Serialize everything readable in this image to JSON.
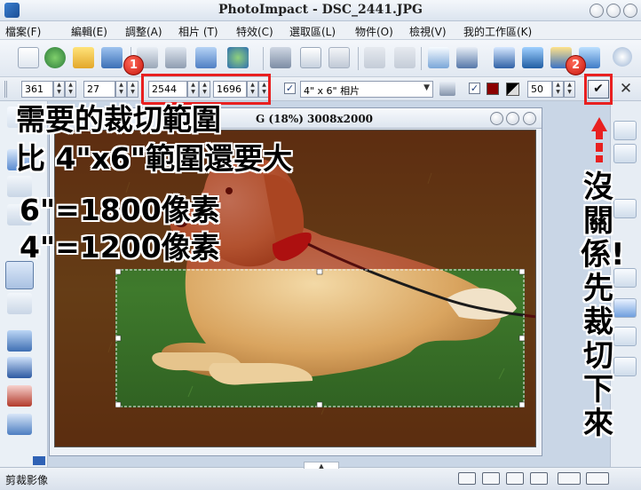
{
  "app": {
    "title": "PhotoImpact - DSC_2441.JPG"
  },
  "menu": {
    "items": [
      "檔案(F)",
      "編輯(E)",
      "調整(A)",
      "相片 (T)",
      "特效(C)",
      "選取區(L)",
      "物件(O)",
      "檢視(V)",
      "我的工作區(K)"
    ]
  },
  "toolbar2": {
    "x": "361",
    "y": "27",
    "width": "2544",
    "height": "1696",
    "preset": "4\" x 6\" 相片",
    "shading": "50"
  },
  "document": {
    "title": "G (18%) 3008x2000"
  },
  "annotations": {
    "badge1": "1",
    "badge2": "2",
    "line1": "需要的裁切範圍",
    "line2": "比 4\"x6\"範圍還要大",
    "line3": "6\"=1800像素",
    "line4": "4\"=1200像素",
    "vertical": "沒關係!先裁切下來"
  },
  "status": {
    "text": "剪裁影像"
  },
  "colors": {
    "callout": "#e82020",
    "shield_color": "#8b0000",
    "accent": "#1f4f9a"
  },
  "icons": [
    "new-file-icon",
    "globe-icon",
    "open-folder-icon",
    "save-icon",
    "print-icon",
    "printer-icon",
    "grid-icon",
    "web-icon",
    "cut-icon",
    "copy-icon",
    "paste-icon",
    "undo-icon",
    "redo-icon",
    "document-icon",
    "scanner-icon",
    "camera-icon",
    "monitor-icon",
    "effects-icon",
    "chart-icon",
    "help-icon"
  ]
}
